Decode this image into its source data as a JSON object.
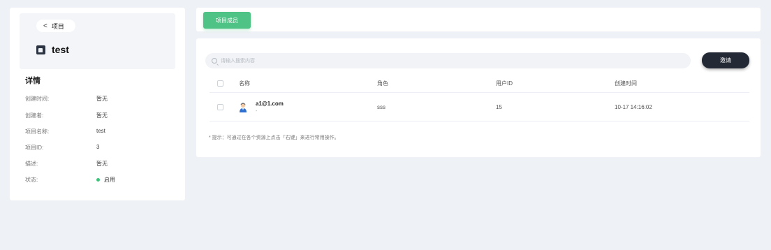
{
  "sidebar": {
    "back_label": "项目",
    "project_name": "test",
    "details_title": "详情",
    "details": [
      {
        "key": "创建时间:",
        "value": "暂无"
      },
      {
        "key": "创建者:",
        "value": "暂无"
      },
      {
        "key": "项目名称:",
        "value": "test"
      },
      {
        "key": "项目ID:",
        "value": "3"
      },
      {
        "key": "描述:",
        "value": "暂无"
      },
      {
        "key": "状态:",
        "value": "启用"
      }
    ],
    "status_color": "#3ec37a"
  },
  "tabs": {
    "active_label": "项目成员"
  },
  "search": {
    "placeholder": "请输入搜索内容"
  },
  "toolbar": {
    "invite_label": "邀请"
  },
  "table": {
    "headers": {
      "name": "名称",
      "role": "角色",
      "user_id": "用户ID",
      "created": "创建时间"
    },
    "rows": [
      {
        "email": "a1@1.com",
        "sub": "-",
        "role": "sss",
        "user_id": "15",
        "created": "10-17 14:16:02"
      }
    ]
  },
  "hint": "* 提示：可通过在各个资源上点击「右键」来进行常用操作。",
  "colors": {
    "accent_green": "#4fc386",
    "dark_button": "#232a35"
  }
}
